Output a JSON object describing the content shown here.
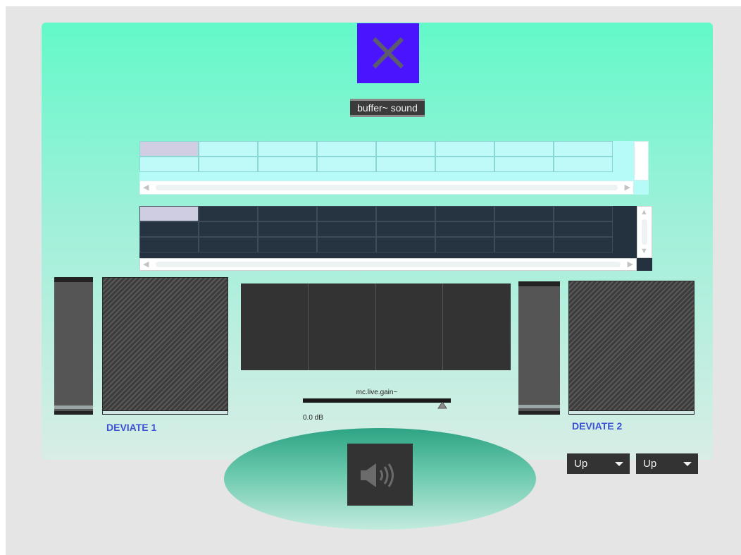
{
  "colors": {
    "panel_top": "#63f9c9",
    "panel_bottom": "#d8ede6",
    "close_tile": "#4a14ff",
    "deviate_label": "#3c52d4",
    "grid_light": "#b7fbf9",
    "grid_dark": "#24323f"
  },
  "close_button": {
    "icon": "close-icon"
  },
  "buffer_object": {
    "label": "buffer~ sound"
  },
  "grid_light": {
    "columns": 8,
    "rows": 2,
    "selected_cell": "row 1, column 1"
  },
  "grid_dark": {
    "columns": 8,
    "rows": 3,
    "selected_cell": "row 1, column 1"
  },
  "deviate1": {
    "label": "DEVIATE 1",
    "slider_level": 0.05
  },
  "deviate2": {
    "label": "DEVIATE 2",
    "slider_level": 0.05
  },
  "meter": {
    "segments": 4
  },
  "gain": {
    "object_name": "mc.live.gain~",
    "value_text": "0.0 dB",
    "level": 0.94
  },
  "audio_toggle": {
    "icon": "speaker-icon"
  },
  "dropdowns": [
    {
      "value": "Up"
    },
    {
      "value": "Up"
    }
  ]
}
